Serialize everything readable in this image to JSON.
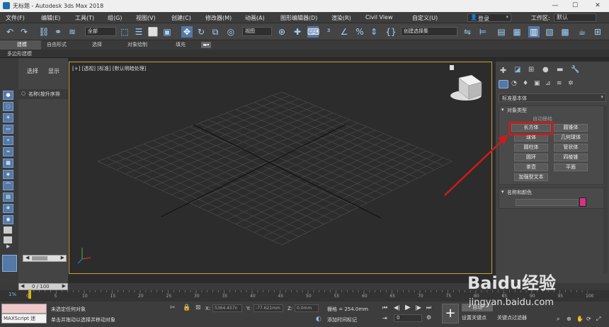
{
  "window": {
    "title": "无标题 - Autodesk 3ds Max 2018"
  },
  "menu": [
    "文件(F)",
    "编辑(E)",
    "工具(T)",
    "组(G)",
    "视图(V)",
    "创建(C)",
    "修改器(M)",
    "动画(A)",
    "图形编辑器(D)",
    "渲染(R)",
    "Civil View",
    "自定义(U)"
  ],
  "header_right": {
    "login": "登录",
    "workspace_label": "工作区:",
    "workspace_value": "默认"
  },
  "toolbar": {
    "selection_filter": "全部",
    "ref_coord": "视图",
    "named_selection": "创建选择集"
  },
  "ribbon": {
    "tabs": [
      "建模",
      "自由形式",
      "选择",
      "对象绘制",
      "填充"
    ],
    "sub_label": "多边形建模"
  },
  "scene_explorer": {
    "tabs": [
      "选择",
      "显示"
    ],
    "header": "名称(按升序排"
  },
  "viewport": {
    "label": "[+] [透视] [标准] [默认明暗处理]"
  },
  "command_panel": {
    "category": "标准基本体",
    "rollout_object_type": "对象类型",
    "autogrid": "自动栅格",
    "buttons": [
      "长方体",
      "圆锥体",
      "球体",
      "几何球体",
      "圆柱体",
      "管状体",
      "圆环",
      "四棱锥",
      "茶壶",
      "平面",
      "加强型文本"
    ],
    "rollout_name_color": "名称和颜色",
    "object_color": "#d63384"
  },
  "timeline": {
    "frame": "0 / 100",
    "ticks": [
      "0",
      "5",
      "10",
      "15",
      "20",
      "25",
      "30",
      "35",
      "40",
      "45",
      "50",
      "55",
      "60",
      "65",
      "70",
      "75",
      "80",
      "85",
      "90",
      "95",
      "100"
    ]
  },
  "status": {
    "script_label": "MAXScript 迷",
    "line1": "未选定任何对象",
    "line2": "单击并拖动以选择并移动对象",
    "x_label": "X:",
    "x_value": "5364.457n",
    "y_label": "Y:",
    "y_value": "-77.621mm",
    "z_label": "Z:",
    "z_value": "0.0mm",
    "grid_label": "栅格 = 254.0mm",
    "add_time_tag": "添加时间标记",
    "frame_input": "0",
    "set_key": "设置关键点",
    "key_filter": "关键点过滤器",
    "auto_key": "自动"
  },
  "watermark": {
    "brand": "Baidu经验",
    "url": "jingyan.baidu.com"
  },
  "colors": {
    "accent": "#5579a6",
    "highlight_red": "#d01a1a",
    "viewport_border": "#c9a23a"
  }
}
